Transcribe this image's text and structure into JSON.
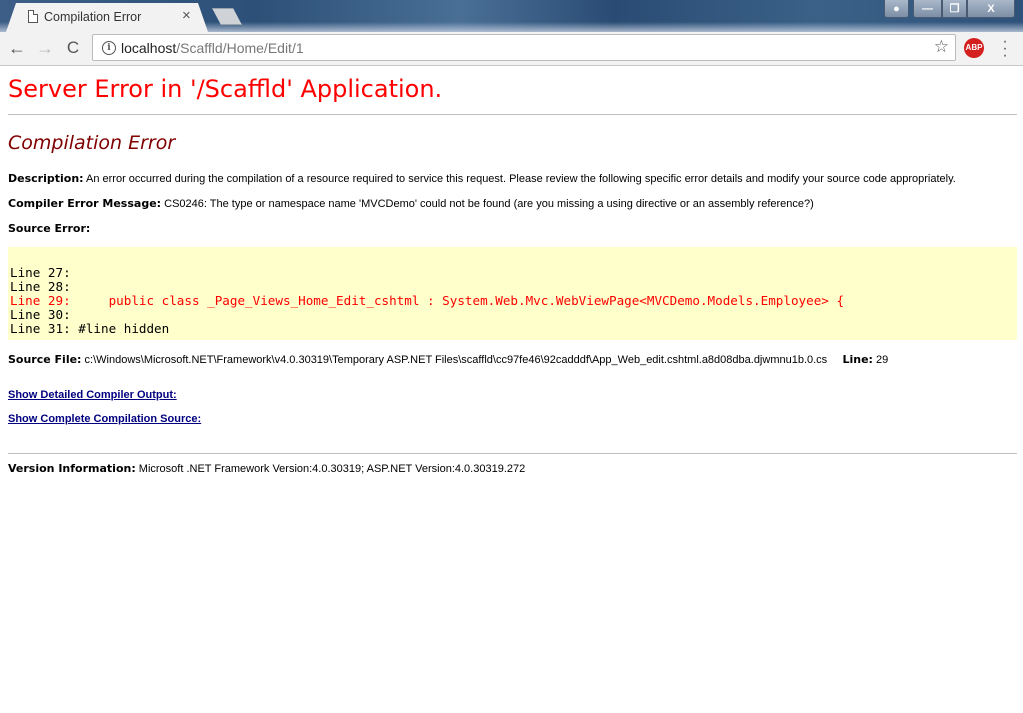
{
  "browser": {
    "tab_title": "Compilation Error",
    "tab_close": "×",
    "url_host": "localhost",
    "url_path": "/Scaffld/Home/Edit/1",
    "back": "←",
    "forward": "→",
    "reload": "C",
    "info": "i",
    "bookmark_star": "☆",
    "abp_label": "ABP",
    "menu": "⋮",
    "window_buttons": {
      "user": "👤",
      "minimize": "—",
      "maximize": "❐",
      "close": "X"
    }
  },
  "page": {
    "title": "Server Error in '/Scaffld' Application.",
    "subtitle": "Compilation Error",
    "description_label": "Description:",
    "description_text": " An error occurred during the compilation of a resource required to service this request. Please review the following specific error details and modify your source code appropriately.",
    "compiler_msg_label": "Compiler Error Message:",
    "compiler_msg_text": " CS0246: The type or namespace name 'MVCDemo' could not be found (are you missing a using directive or an assembly reference?)",
    "source_error_label": "Source Error:",
    "source_lines": [
      {
        "text": "Line 27: ",
        "error": false
      },
      {
        "text": "Line 28: ",
        "error": false
      },
      {
        "text": "Line 29:     public class _Page_Views_Home_Edit_cshtml : System.Web.Mvc.WebViewPage<MVCDemo.Models.Employee> {",
        "error": true
      },
      {
        "text": "Line 30: ",
        "error": false
      },
      {
        "text": "Line 31: #line hidden",
        "error": false
      }
    ],
    "source_file_label": "Source File:",
    "source_file_path": " c:\\Windows\\Microsoft.NET\\Framework\\v4.0.30319\\Temporary ASP.NET Files\\scaffld\\cc97fe46\\92cadddf\\App_Web_edit.cshtml.a8d08dba.djwmnu1b.0.cs",
    "line_label": "Line:",
    "line_value": " 29",
    "link_compiler_output": "Show Detailed Compiler Output:",
    "link_compilation_source": "Show Complete Compilation Source:",
    "version_label": "Version Information:",
    "version_text": " Microsoft .NET Framework Version:4.0.30319; ASP.NET Version:4.0.30319.272"
  },
  "colors": {
    "title_red": "#ff0000",
    "subtitle_maroon": "#800000",
    "code_bg": "#ffffcc",
    "link_navy": "#000080"
  }
}
